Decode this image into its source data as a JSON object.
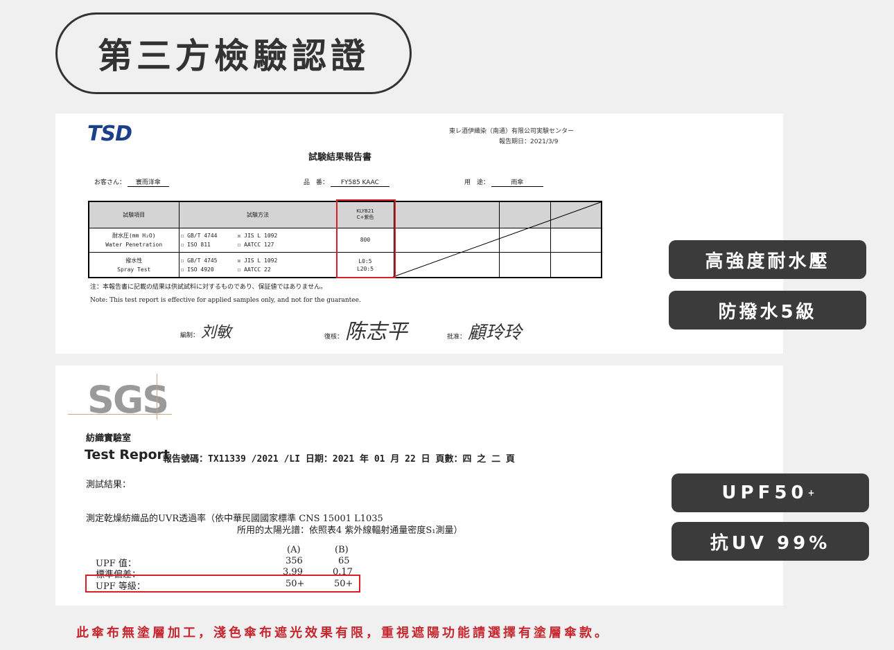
{
  "title": "第三方檢驗認證",
  "doc1": {
    "logo": "TSD",
    "lab_name": "東レ酒伊織染（南通）有限公司実験センター",
    "report_date": "報告期日：2021/3/9",
    "report_title": "試験結果報告書",
    "client_label": "お客さん：",
    "client_value": "寰而洋傘",
    "item_label": "品　番：",
    "item_value": "FY585 KAAC",
    "use_label": "用　途：",
    "use_value": "雨傘",
    "headers": {
      "test_item": "試験項目",
      "method": "試験方法",
      "sample": "KLYB21\nC+紫色"
    },
    "row1": {
      "item_jp": "耐水圧(mm H₂O)",
      "item_en": "Water Penetration",
      "methods": [
        "☐ GB/T 4744",
        "☒ JIS L 1092",
        "☐ ISO 811",
        "☐ AATCC 127"
      ],
      "value": "800"
    },
    "row2": {
      "item_jp": "撥水性",
      "item_en": "Spray Test",
      "methods": [
        "☐ GB/T 4745",
        "☒ JIS L 1092",
        "☐ ISO 4920",
        "☐ AATCC 22"
      ],
      "value": "L0:5",
      "value2": "L20:5"
    },
    "note_jp": "注：本報告書に記載の結果は供試試料に対するものであり、保証値ではありません。",
    "note_en": "Note: This test report is effective for applied samples only, and not for the guarantee.",
    "sig1_label": "編制：",
    "sig1": "刘敏",
    "sig2_label": "復核：",
    "sig2": "陈志平",
    "sig3_label": "批准：",
    "sig3": "顧玲玲"
  },
  "doc2": {
    "logo": "SGS",
    "lab": "紡織實驗室",
    "test_report": "Test Report",
    "report_line": "報告號碼：TX11339 /2021 /LI 日期：2021 年 01 月 22 日 頁數：四 之 二 頁",
    "result_label": "測試結果：",
    "desc1": "測定乾燥紡織品的UVR透過率（依中華民國國家標準 CNS 15001 L1035",
    "desc2": "所用的太陽光譜：依照表4 紫外線輻射通量密度S₁測量）",
    "col_a": "(A)",
    "col_b": "(B)",
    "rows": [
      {
        "label": "UPF 值：",
        "a": "356",
        "b": "65"
      },
      {
        "label": "標準偏差：",
        "a": "3.99",
        "b": "0.17"
      },
      {
        "label": "UPF 等級：",
        "a": "50+",
        "b": "50+"
      }
    ]
  },
  "badges": {
    "b1": "高強度耐水壓",
    "b2": "防撥水5級",
    "b3": "UPF50",
    "b3_sup": "+",
    "b4": "抗UV 99%"
  },
  "footnote": "此傘布無塗層加工，淺色傘布遮光效果有限，重視遮陽功能請選擇有塗層傘款。",
  "colors": {
    "badge_bg": "#3b3b3b",
    "highlight_red": "#d61f26",
    "footnote_red": "#c8262e",
    "tsd_blue": "#1c3f8c"
  }
}
